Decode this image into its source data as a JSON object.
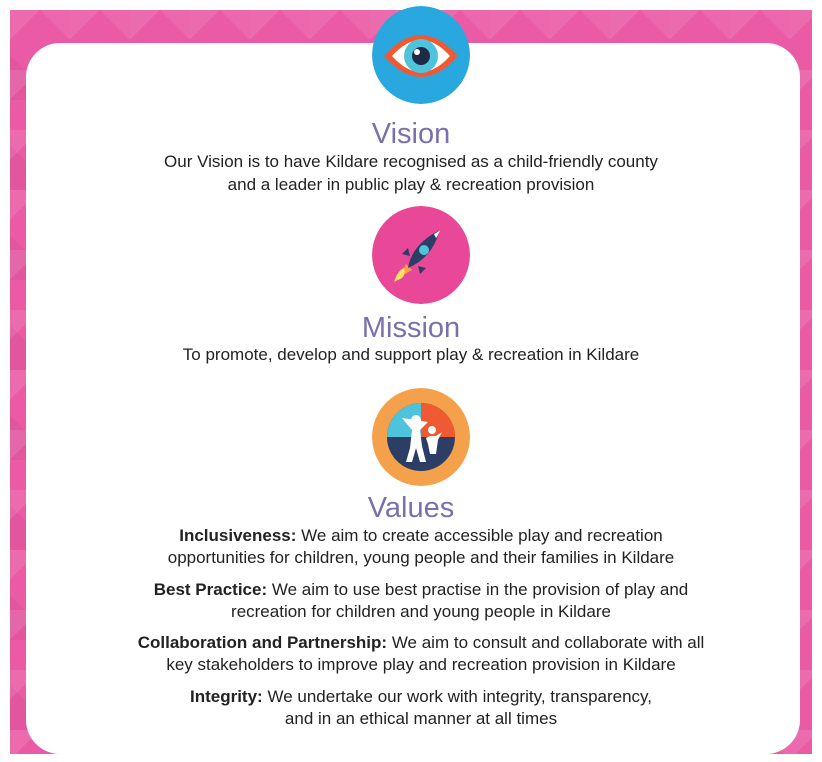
{
  "colors": {
    "background_pink": "#ea5aa5",
    "card": "#ffffff",
    "heading_purple": "#7b6fae",
    "body_text": "#222222",
    "vision_icon_bg": "#29a8e0",
    "mission_icon_bg": "#e94797",
    "values_icon_bg": "#f5a04a"
  },
  "vision": {
    "icon": "eye-icon",
    "title": "Vision",
    "line1": "Our Vision is to have Kildare recognised as a child-friendly county",
    "line2": "and a leader in public play & recreation provision"
  },
  "mission": {
    "icon": "rocket-icon",
    "title": "Mission",
    "line1": "To promote, develop and support play & recreation in Kildare"
  },
  "values": {
    "icon": "people-icon",
    "title": "Values",
    "items": [
      {
        "label": "Inclusiveness:",
        "line1": "We aim to create accessible play and recreation",
        "line2": "opportunities for children, young people and their families in Kildare"
      },
      {
        "label": "Best Practice:",
        "line1": "We aim to use best practise in the provision of play and",
        "line2": "recreation for children and young people in Kildare"
      },
      {
        "label": "Collaboration and Partnership:",
        "line1": "We aim to consult and collaborate with all",
        "line2": "key stakeholders to improve play and recreation provision in Kildare"
      },
      {
        "label": "Integrity:",
        "line1": "We undertake our work with integrity, transparency,",
        "line2": "and in an ethical manner at all times"
      }
    ]
  }
}
